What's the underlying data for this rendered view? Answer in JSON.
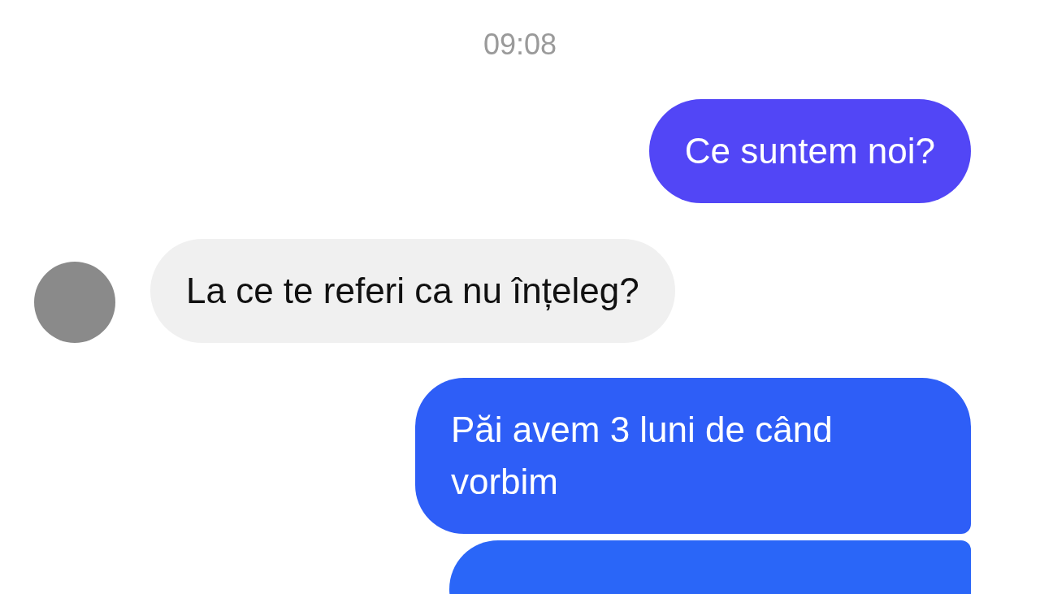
{
  "timestamp": "09:08",
  "messages": [
    {
      "kind": "outgoing",
      "text": "Ce suntem noi?",
      "color": "#5246f6"
    },
    {
      "kind": "incoming",
      "text": "La ce te referi ca nu înțeleg?"
    },
    {
      "kind": "outgoing",
      "text": "Păi avem 3 luni de când vorbim",
      "color": "#2e5ef7"
    },
    {
      "kind": "outgoing",
      "color": "#2a66f8"
    }
  ]
}
